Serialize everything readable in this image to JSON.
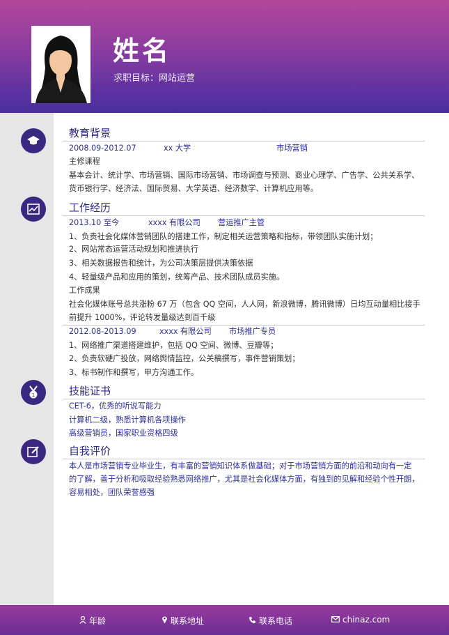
{
  "header": {
    "name": "姓名",
    "objective": "求职目标：网站运营"
  },
  "education": {
    "title": "教育背景",
    "period": "2008.09-2012.07",
    "school": "xx 大学",
    "major": "市场营销",
    "courses_label": "主修课程",
    "courses_line1": "基本会计、统计学、市场营销、国际市场营销、市场调查与预测、商业心理学、广告学、公共关系学、",
    "courses_line2": "货币银行学、经济法、国际贸易、大学英语、经济数学、计算机应用等。"
  },
  "work": {
    "title": "工作经历",
    "job1": {
      "period": "2013.10 至今",
      "company": "xxxx 有限公司",
      "position": "营运推广主管",
      "duties": [
        "1、负责社会化媒体营销团队的搭建工作，制定相关运营策略和指标，带领团队实施计划；",
        "2、网站常态运营活动规划和推进执行",
        "3、相关数据报告和统计，为公司决策层提供决策依据",
        "4、轻量级产品和应用的策划，统筹产品、技术团队成员实施。"
      ],
      "results_label": "工作成果",
      "results_line1": "社会化媒体账号总共涨粉 67 万（包含 QQ 空间，人人网，新浪微博，腾讯微博）日均互动量相比接手",
      "results_line2": "前提升 1000%，评论转发量级达到百千级"
    },
    "job2": {
      "period": "2012.08-2013.09",
      "company": "xxxx 有限公司",
      "position": "市场推广专员",
      "duties": [
        "1、网络推广渠道搭建维护，包括 QQ 空间、微博、豆瓣等；",
        "2、负责软硬广投放，网络舆情监控，公关稿撰写，事件营销策划；",
        "3、标书制作和撰写，甲方沟通工作。"
      ]
    }
  },
  "skills": {
    "title": "技能证书",
    "items": [
      "CET-6，优秀的听说写能力",
      "计算机二级，熟悉计算机各项操作",
      "高级营销员，国家职业资格四级"
    ]
  },
  "self": {
    "title": "自我评价",
    "line1": "本人是市场营销专业毕业生，有丰富的营销知识体系做基础；对于市场营销方面的前沿和动向有一定",
    "line2": "的了解，善于分析和吸取经验熟悉网络推广，尤其是社会化媒体方面，有独到的见解和经验个性开朗，",
    "line3": "容易相处，团队荣誉感强"
  },
  "footer": {
    "age": "年龄",
    "address": "联系地址",
    "phone": "联系电话",
    "email": "chinaz.com"
  },
  "colors": {
    "accent": "#2f2a86",
    "header_purple": "#8a3c9f",
    "sidebar": "#e6e6e6"
  },
  "icons": [
    "graduation-cap-icon",
    "chart-icon",
    "medal-icon",
    "edit-icon",
    "person-icon",
    "location-pin-icon",
    "phone-icon",
    "mail-icon"
  ]
}
